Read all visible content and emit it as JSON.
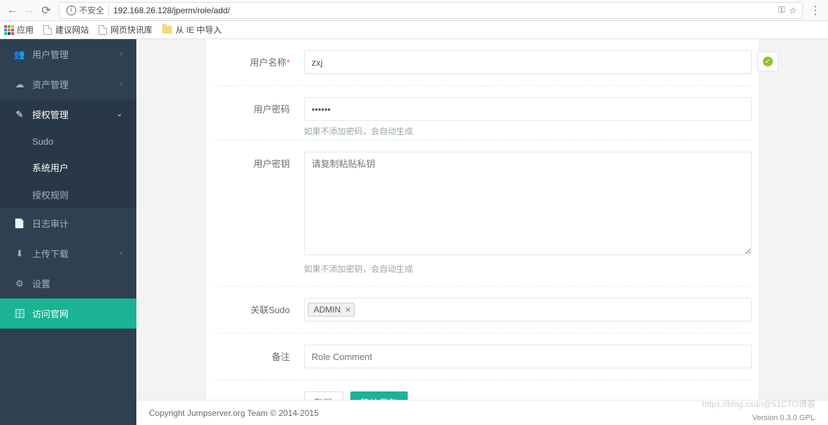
{
  "browser": {
    "insecure_label": "不安全",
    "url": "192.168.26.128/jperm/role/add/"
  },
  "bookmarks": {
    "apps": "应用",
    "recommend": "建议网站",
    "quick": "网页快讯库",
    "ie_import": "从 IE 中导入"
  },
  "sidebar": {
    "user_mgmt": "用户管理",
    "asset_mgmt": "资产管理",
    "perm_mgmt": "授权管理",
    "sudo": "Sudo",
    "sys_user": "系统用户",
    "perm_rule": "授权规则",
    "log_audit": "日志审计",
    "upload": "上传下载",
    "settings": "设置",
    "visit_official": "访问官网"
  },
  "form": {
    "username_label": "用户名称",
    "username_value": "zxj",
    "password_label": "用户密码",
    "password_value": "••••••",
    "password_help": "如果不添加密码，会自动生成",
    "key_label": "用户密钥",
    "key_placeholder": "请复制粘贴私钥",
    "key_help": "如果不添加密钥，会自动生成",
    "sudo_label": "关联Sudo",
    "sudo_tag": "ADMIN",
    "comment_label": "备注",
    "comment_placeholder": "Role Comment",
    "cancel": "取消",
    "submit": "确认保存"
  },
  "footer": {
    "copyright": "Copyright Jumpserver.org Team © 2014-2015",
    "version": "Version 0.3.0 GPL."
  },
  "watermark": "https://blog.csdn@51CTO博客"
}
